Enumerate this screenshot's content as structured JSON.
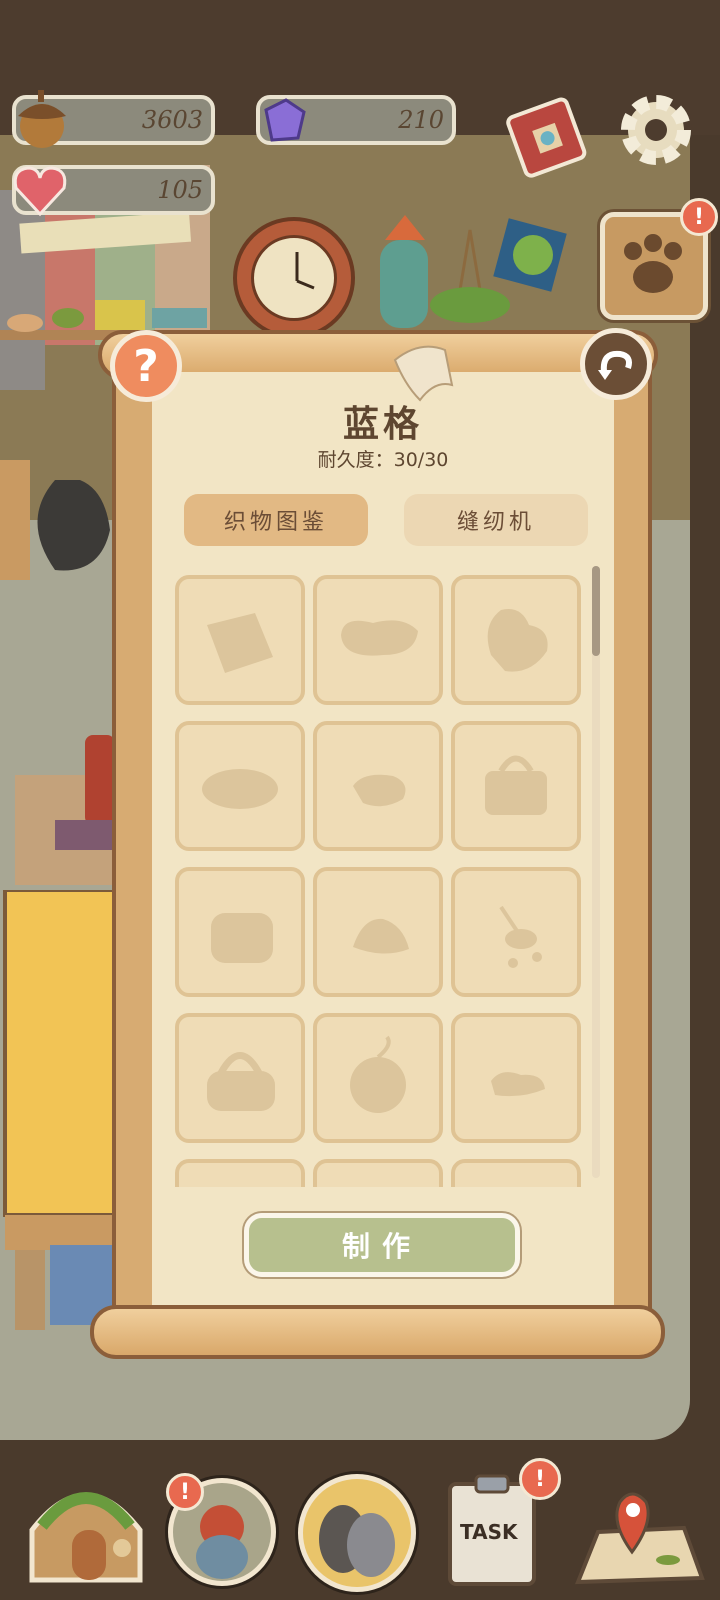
{
  "resources": {
    "acorns": "3603",
    "gems": "210",
    "hearts": "105"
  },
  "panel": {
    "title": "蓝格",
    "durability": "耐久度：30/30",
    "tabs": [
      {
        "label": "织物图鉴",
        "active": true
      },
      {
        "label": "缝纫机",
        "active": false
      }
    ],
    "make_button": "制作",
    "help_label": "?",
    "grid_items": [
      "cloth-silhouette",
      "pillow-silhouette",
      "mitten-silhouette",
      "rug-silhouette",
      "cushion-silhouette",
      "bag-silhouette",
      "pouch-silhouette",
      "hat-silhouette",
      "mobile-silhouette",
      "handbag-silhouette",
      "ball-silhouette",
      "slipper-silhouette",
      "locked",
      "locked",
      "locked"
    ]
  },
  "nav": {
    "items": [
      "home",
      "character",
      "friends",
      "task",
      "map"
    ],
    "task_label": "TASK"
  },
  "badges": {
    "paw": "!",
    "character": "!",
    "task": "!"
  },
  "colors": {
    "accent_orange": "#ef8c5f",
    "make_green": "#b7c08e",
    "paper": "#f2e5c5",
    "badge_red": "#e8694f"
  }
}
